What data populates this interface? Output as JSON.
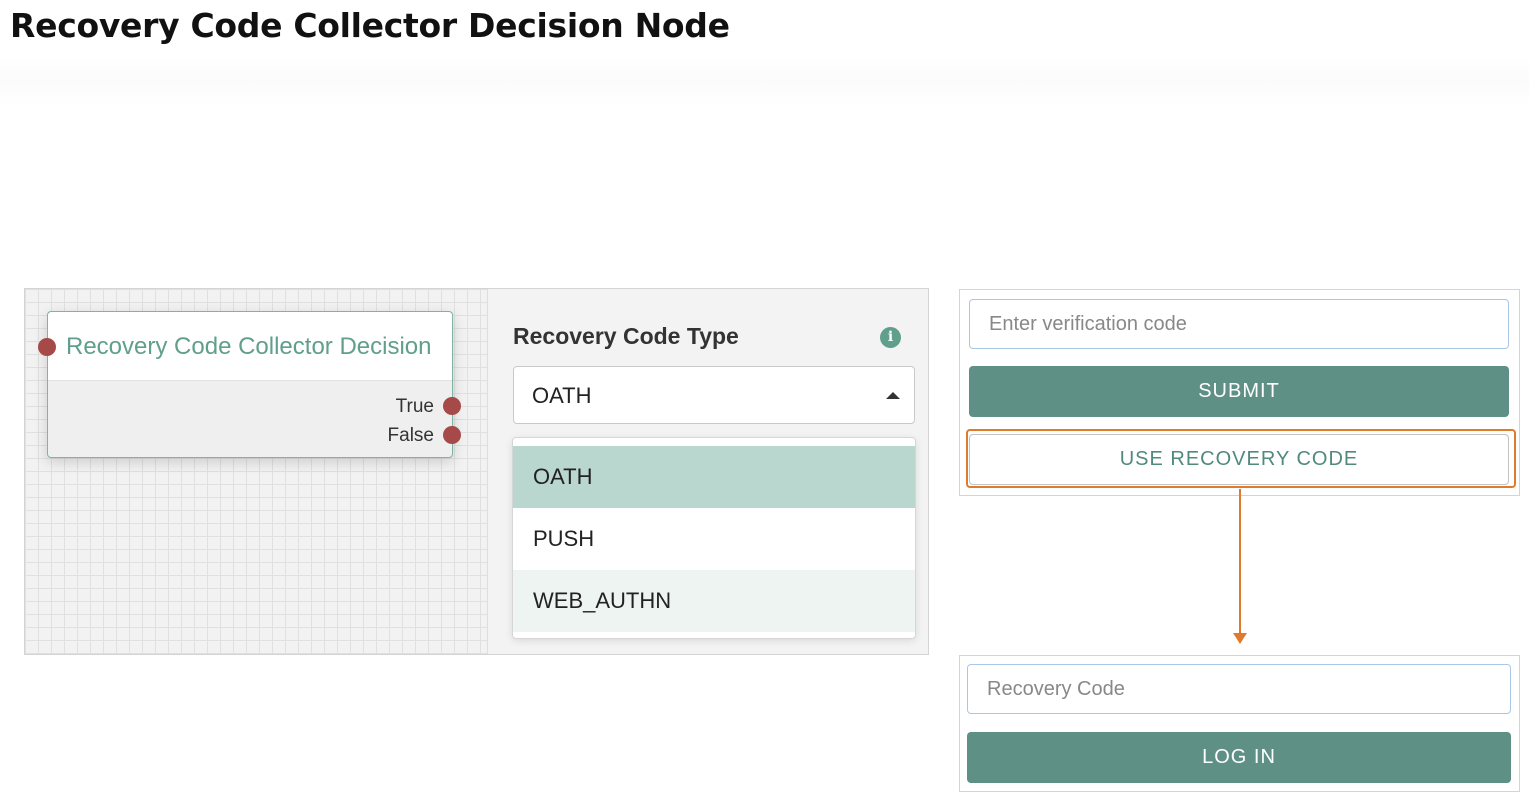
{
  "page": {
    "title": "Recovery Code Collector Decision Node"
  },
  "node": {
    "title": "Recovery Code Collector Decision",
    "outcomes": [
      {
        "label": "True"
      },
      {
        "label": "False"
      }
    ]
  },
  "properties": {
    "label": "Recovery Code Type",
    "info_icon": "info-icon",
    "selected_value": "OATH",
    "options": [
      {
        "label": "OATH",
        "state": "selected"
      },
      {
        "label": "PUSH",
        "state": "normal"
      },
      {
        "label": "WEB_AUTHN",
        "state": "hover"
      }
    ]
  },
  "verification_form": {
    "code_placeholder": "Enter verification code",
    "code_value": "",
    "submit_label": "SUBMIT",
    "recovery_label": "USE RECOVERY CODE"
  },
  "recovery_form": {
    "code_placeholder": "Recovery Code",
    "code_value": "",
    "login_label": "LOG IN"
  },
  "colors": {
    "accent": "#5f9f8b",
    "button": "#5f9085",
    "port": "#a54a48",
    "highlight": "#e07a2c",
    "selected_option": "#b9d6cf"
  }
}
